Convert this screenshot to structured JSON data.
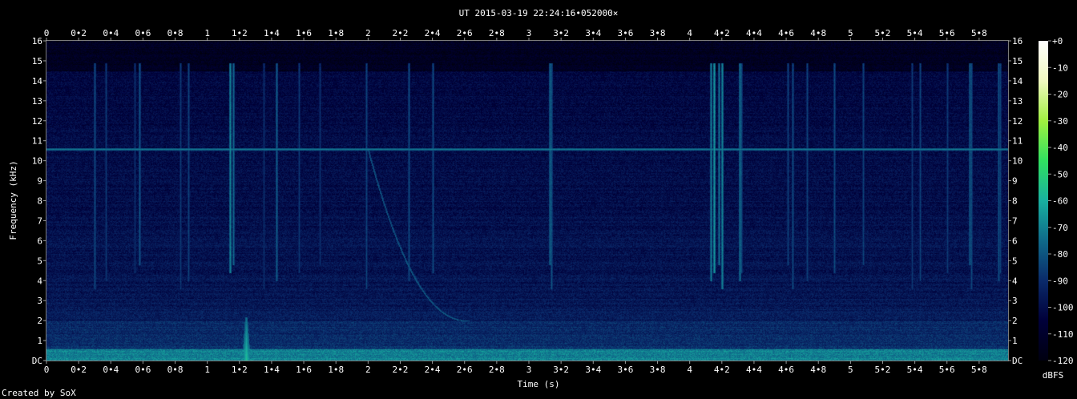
{
  "chart_data": {
    "type": "heatmap",
    "title": "UT 2015-03-19 22:24:16•052000×",
    "xlabel": "Time (s)",
    "ylabel": "Frequency (kHz)",
    "credit": "Created by SoX",
    "colorbar_label": "dBFS",
    "xlim": [
      0,
      5.98
    ],
    "ylim": [
      0,
      16
    ],
    "x_ticks": [
      "0",
      "0•2",
      "0•4",
      "0•6",
      "0•8",
      "1",
      "1•2",
      "1•4",
      "1•6",
      "1•8",
      "2",
      "2•2",
      "2•4",
      "2•6",
      "2•8",
      "3",
      "3•2",
      "3•4",
      "3•6",
      "3•8",
      "4",
      "4•2",
      "4•4",
      "4•6",
      "4•8",
      "5",
      "5•2",
      "5•4",
      "5•6",
      "5•8"
    ],
    "x_tick_values": [
      0,
      0.2,
      0.4,
      0.6,
      0.8,
      1.0,
      1.2,
      1.4,
      1.6,
      1.8,
      2.0,
      2.2,
      2.4,
      2.6,
      2.8,
      3.0,
      3.2,
      3.4,
      3.6,
      3.8,
      4.0,
      4.2,
      4.4,
      4.6,
      4.8,
      5.0,
      5.2,
      5.4,
      5.6,
      5.8
    ],
    "y_ticks": [
      "DC",
      "1",
      "2",
      "3",
      "4",
      "5",
      "6",
      "7",
      "8",
      "9",
      "10",
      "11",
      "12",
      "13",
      "14",
      "15",
      "16"
    ],
    "y_tick_values": [
      0,
      1,
      2,
      3,
      4,
      5,
      6,
      7,
      8,
      9,
      10,
      11,
      12,
      13,
      14,
      15,
      16
    ],
    "colorbar_ticks": [
      "+0",
      "-10",
      "-20",
      "-30",
      "-40",
      "-50",
      "-60",
      "-70",
      "-80",
      "-90",
      "-100",
      "-110",
      "-120"
    ],
    "colorbar_values": [
      0,
      -10,
      -20,
      -30,
      -40,
      -50,
      -60,
      -70,
      -80,
      -90,
      -100,
      -110,
      -120
    ],
    "colorbar_range": [
      -120,
      0
    ],
    "colormap": [
      "#000010",
      "#00003a",
      "#0a2a6a",
      "#0f6a8a",
      "#18b0a0",
      "#30e060",
      "#a0f040",
      "#f0f8c0",
      "#ffffff"
    ],
    "features": {
      "constant_tone_khz": 10.6,
      "constant_tone_level_dbfs": -72,
      "low_band_level_dbfs": -68,
      "whistler": {
        "t_start_s": 2.0,
        "f_start_khz": 10.5,
        "t_end_s": 2.62,
        "f_end_khz": 2.0,
        "level_dbfs": -80
      },
      "impulse_times_s": [
        0.3,
        0.37,
        0.55,
        0.58,
        0.83,
        0.88,
        1.14,
        1.16,
        1.35,
        1.43,
        1.57,
        1.7,
        1.99,
        2.25,
        2.4,
        3.13,
        3.14,
        4.13,
        4.15,
        4.18,
        4.2,
        4.31,
        4.32,
        4.61,
        4.64,
        4.73,
        4.9,
        5.08,
        5.38,
        5.43,
        5.6,
        5.74,
        5.75,
        5.92,
        5.93
      ],
      "impulse_levels_dbfs": [
        -82,
        -86,
        -88,
        -80,
        -86,
        -84,
        -70,
        -76,
        -88,
        -78,
        -86,
        -88,
        -84,
        -82,
        -82,
        -76,
        -80,
        -72,
        -66,
        -74,
        -70,
        -74,
        -82,
        -84,
        -82,
        -84,
        -82,
        -84,
        -86,
        -84,
        -86,
        -78,
        -82,
        -80,
        -84
      ],
      "bright_burst": {
        "t_s": 1.24,
        "f_top_khz": 2.2,
        "level_dbfs": -55
      }
    }
  }
}
